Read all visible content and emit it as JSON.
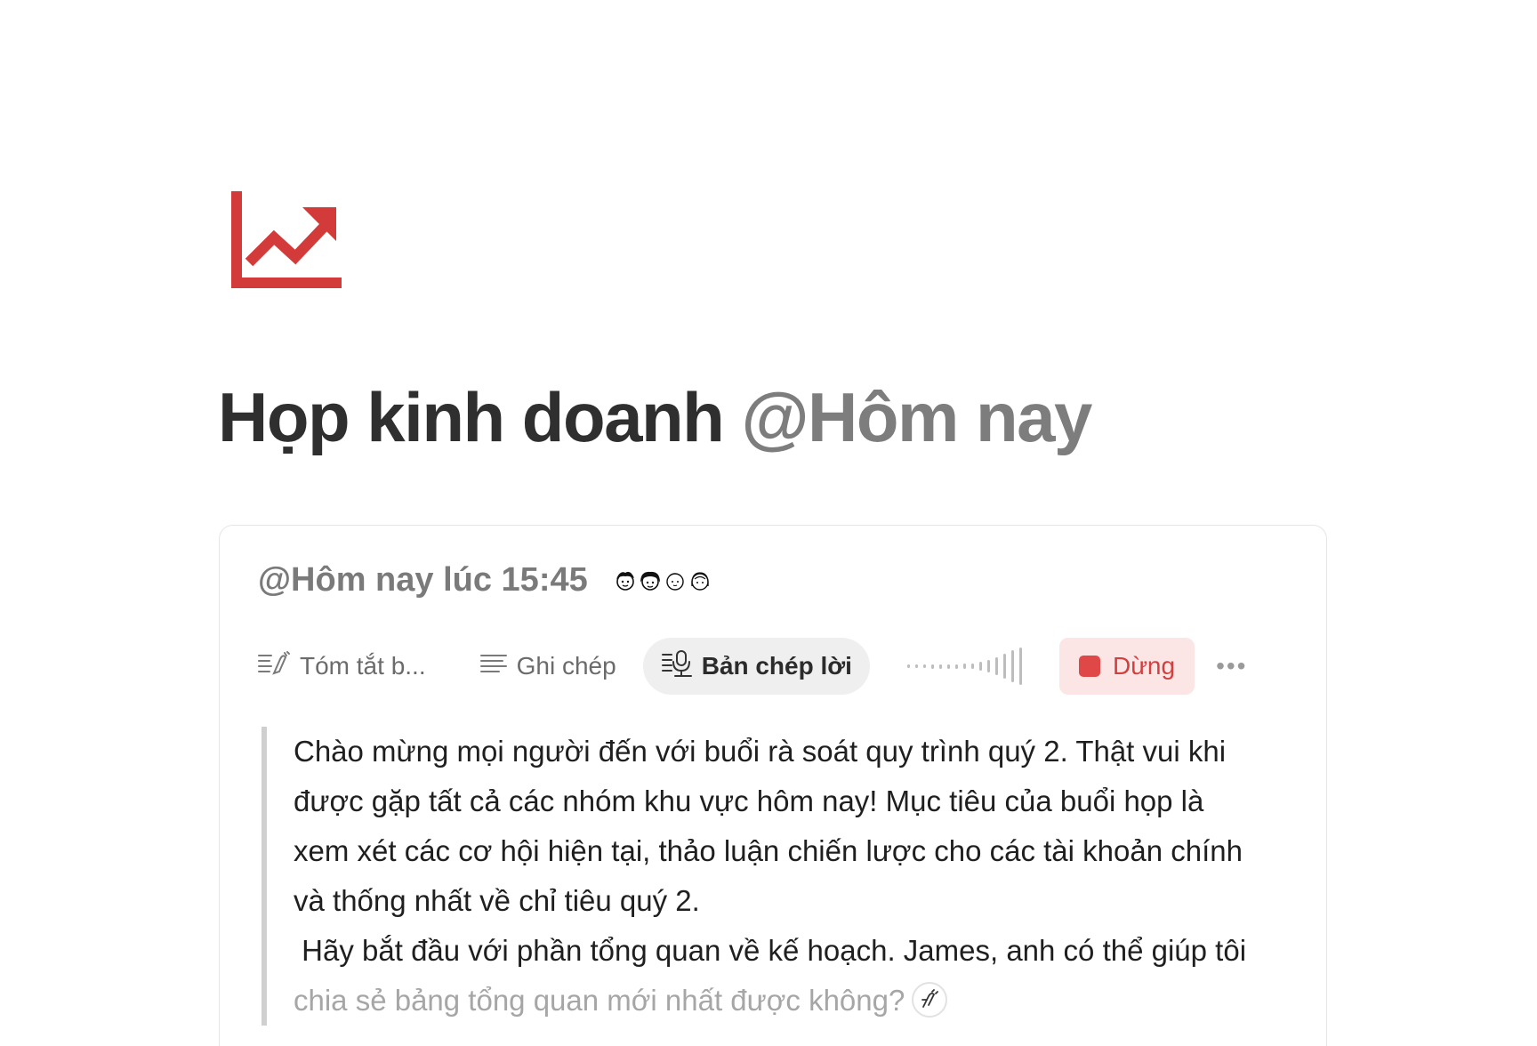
{
  "page": {
    "icon": "trend-up-chart-icon",
    "icon_color": "#d33b3b",
    "title": "Họp kinh doanh",
    "title_mention": "@Hôm nay"
  },
  "meeting": {
    "datetime": "@Hôm nay lúc 15:45",
    "participants": [
      "participant-avatar",
      "participant-avatar",
      "participant-avatar",
      "participant-avatar"
    ]
  },
  "tabs": [
    {
      "label": "Tóm tắt b...",
      "icon": "summary-icon",
      "active": false
    },
    {
      "label": "Ghi chép",
      "icon": "notes-icon",
      "active": false
    },
    {
      "label": "Bản chép lời",
      "icon": "transcript-icon",
      "active": true
    }
  ],
  "recording": {
    "stop_label": "Dừng",
    "stop_color": "#e04848",
    "more_label": "•••"
  },
  "transcript": {
    "paragraph1": "Chào mừng mọi người đến với buổi rà soát quy trình quý 2. Thật vui khi được gặp tất cả các nhóm khu vực hôm nay! Mục tiêu của buổi họp là xem xét các cơ hội hiện tại, thảo luận chiến lược cho các tài khoản chính và thống nhất về chỉ tiêu quý 2.",
    "paragraph2_final": "Hãy bắt đầu với phần tổng quan về kế hoạch. James, anh có thể giúp tôi",
    "paragraph2_pending": "chia sẻ bảng tổng quan mới nhất được không?"
  }
}
